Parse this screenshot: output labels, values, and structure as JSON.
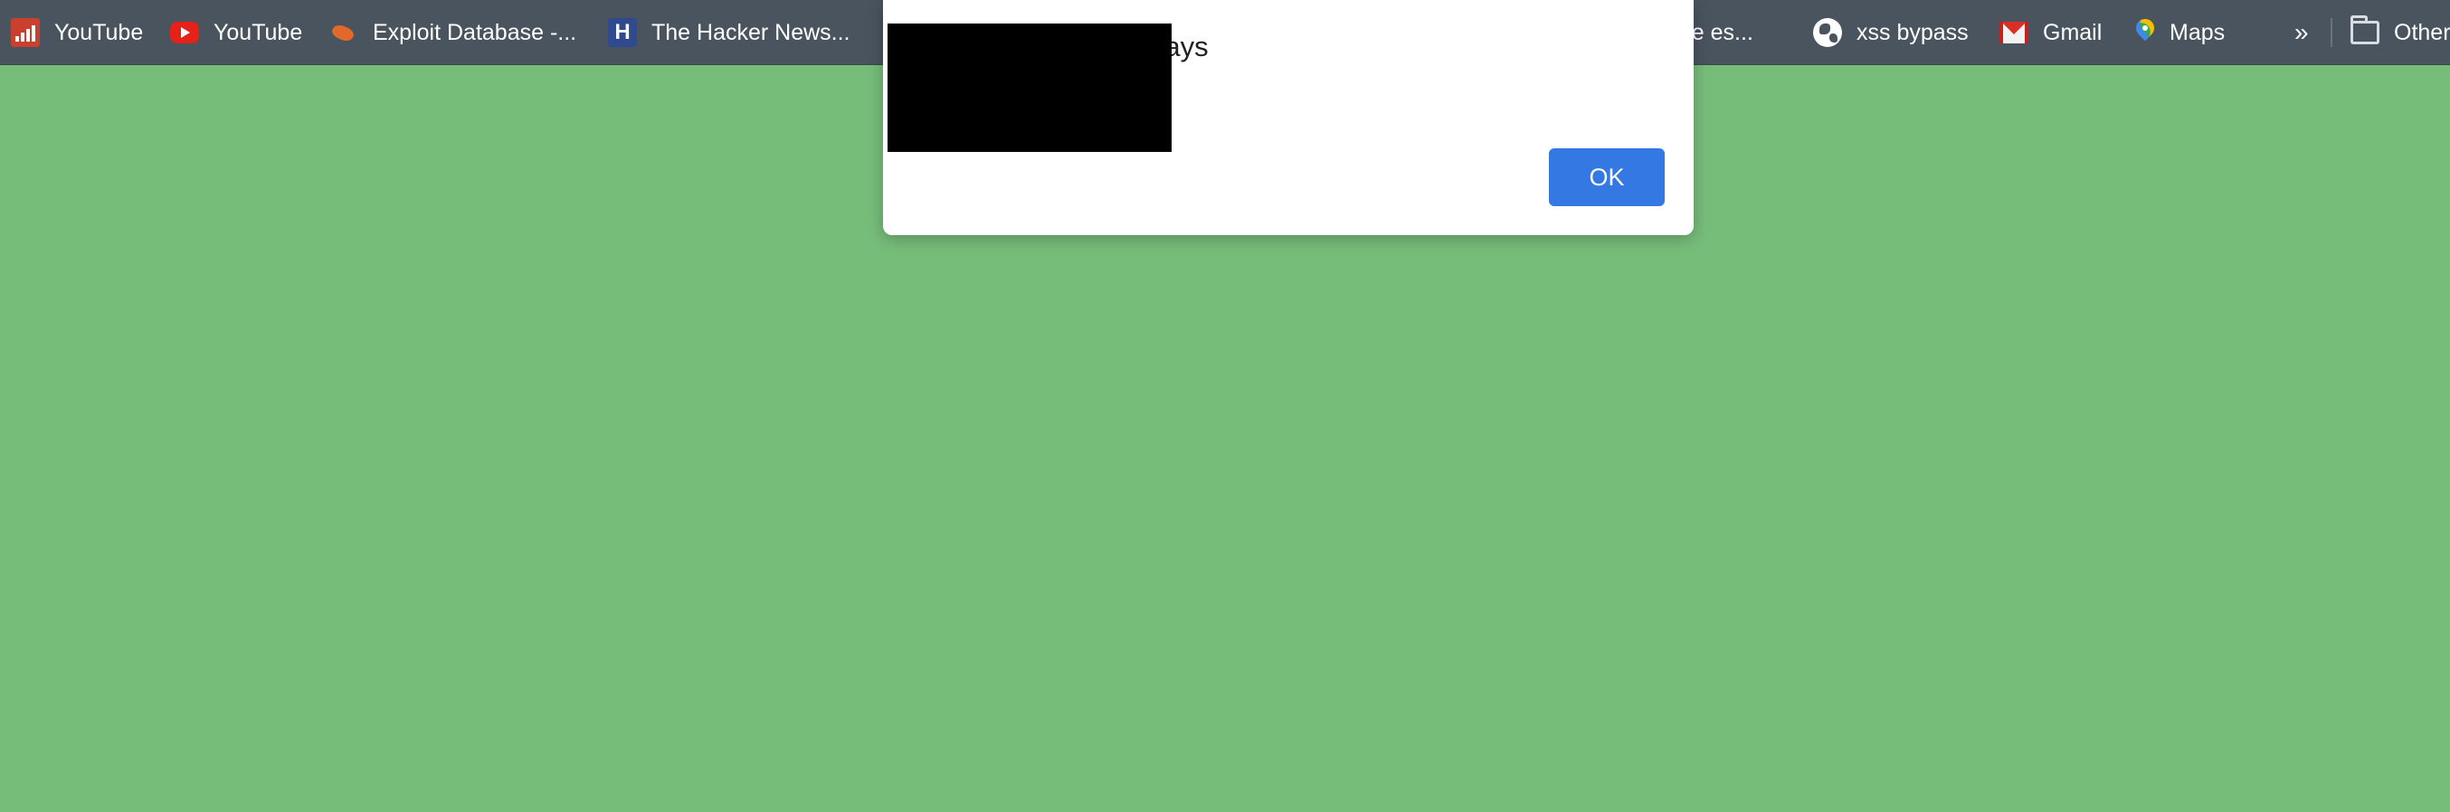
{
  "bookmarks": {
    "items": [
      {
        "label": "YouTube",
        "icon": "analytics-icon"
      },
      {
        "label": "YouTube",
        "icon": "youtube-icon"
      },
      {
        "label": "Exploit Database -...",
        "icon": "exploit-db-icon"
      },
      {
        "label": "The Hacker News...",
        "icon": "hacker-news-icon"
      },
      {
        "label": "ege es...",
        "icon": ""
      },
      {
        "label": "xss bypass",
        "icon": "globe-icon"
      },
      {
        "label": "Gmail",
        "icon": "gmail-icon"
      },
      {
        "label": "Maps",
        "icon": "maps-icon"
      }
    ],
    "overflow": "»",
    "other_label": "Other"
  },
  "dialog": {
    "title": "n says",
    "ok_label": "OK"
  },
  "colors": {
    "page_background": "#77bd7a",
    "bar_background": "#4a545f",
    "ok_button": "#3478e3"
  }
}
